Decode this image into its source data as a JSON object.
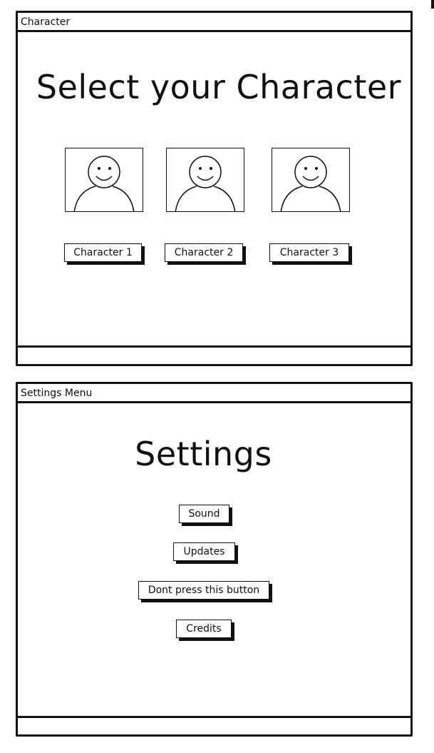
{
  "character_window": {
    "title": "Character",
    "heading": "Select your Character",
    "characters": [
      {
        "label": "Character 1",
        "icon": "person-icon"
      },
      {
        "label": "Character 2",
        "icon": "person-icon"
      },
      {
        "label": "Character 3",
        "icon": "person-icon"
      }
    ]
  },
  "settings_window": {
    "title": "Settings Menu",
    "heading": "Settings",
    "buttons": [
      {
        "label": "Sound"
      },
      {
        "label": "Updates"
      },
      {
        "label": "Dont press this button"
      },
      {
        "label": "Credits"
      }
    ]
  }
}
